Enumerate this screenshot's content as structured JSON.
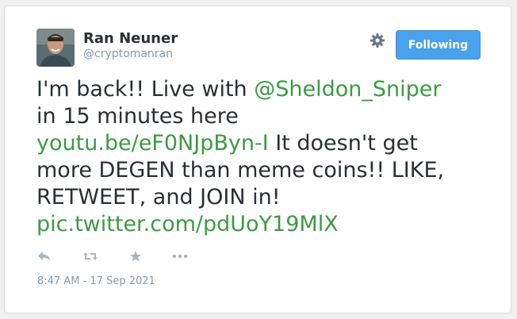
{
  "tweet": {
    "author_name": "Ran Neuner",
    "author_handle": "@cryptomanran",
    "follow_button_label": "Following",
    "text": {
      "part1": "I'm back!! Live with ",
      "mention": "@Sheldon_Sniper",
      "part2": "in 15 minutes here",
      "url_link": "youtu.be/eF0NJpByn-I",
      "part3": " It doesn't get",
      "part4": "more DEGEN than meme coins!! LIKE,",
      "part5": "RETWEET, and JOIN in!",
      "pic_link": "pic.twitter.com/pdUoY19MlX"
    },
    "timestamp": "8:47 AM - 17 Sep 2021",
    "actions": [
      "reply-icon",
      "retweet-icon",
      "like-icon",
      "more-icon"
    ]
  },
  "colors": {
    "link": "#3c9a43",
    "button": "#4aa1ec",
    "text": "#292f33",
    "muted": "#8899a6",
    "icon": "#a8b4bd"
  }
}
